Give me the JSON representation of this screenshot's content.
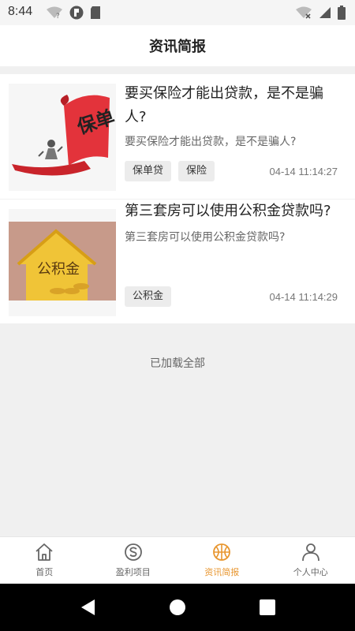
{
  "status_bar": {
    "time": "8:44"
  },
  "header": {
    "title": "资讯简报"
  },
  "news": [
    {
      "title": "要买保险才能出贷款，是不是骗人?",
      "summary": "要买保险才能出贷款，是不是骗人?",
      "tags": [
        "保单贷",
        "保险"
      ],
      "time": "04-14 11:14:27",
      "image_text": "保单"
    },
    {
      "title": "第三套房可以使用公积金贷款吗?",
      "summary": "第三套房可以使用公积金贷款吗?",
      "tags": [
        "公积金"
      ],
      "time": "04-14 11:14:29",
      "image_text": "公积金"
    }
  ],
  "feed_footer": "已加载全部",
  "tabbar": {
    "items": [
      {
        "label": "首页",
        "icon": "home-icon"
      },
      {
        "label": "盈利项目",
        "icon": "skype-icon"
      },
      {
        "label": "资讯简报",
        "icon": "basketball-icon"
      },
      {
        "label": "个人中心",
        "icon": "person-icon"
      }
    ],
    "active": "资讯简报",
    "active_color": "#e8962f",
    "inactive_color": "#666666"
  }
}
